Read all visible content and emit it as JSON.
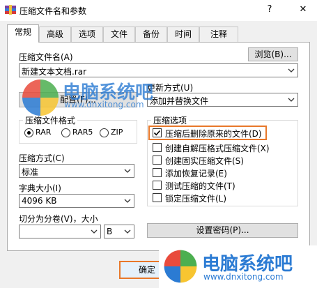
{
  "window": {
    "title": "压缩文件名和参数",
    "help": "?",
    "close": "✕"
  },
  "tabs": [
    "常规",
    "高级",
    "选项",
    "文件",
    "备份",
    "时间",
    "注释"
  ],
  "archive": {
    "label": "压缩文件名(A)",
    "value": "新建文本文档.rar",
    "browse": "浏览(B)..."
  },
  "profile": {
    "button": "配置(F)..."
  },
  "update": {
    "label": "更新方式(U)",
    "value": "添加并替换文件"
  },
  "format": {
    "label": "压缩文件格式",
    "options": [
      "RAR",
      "RAR5",
      "ZIP"
    ],
    "selected": "RAR"
  },
  "options": {
    "label": "压缩选项",
    "items": [
      {
        "label": "压缩后删除原来的文件(D)",
        "checked": true
      },
      {
        "label": "创建自解压格式压缩文件(X)",
        "checked": false
      },
      {
        "label": "创建固实压缩文件(S)",
        "checked": false
      },
      {
        "label": "添加恢复记录(E)",
        "checked": false
      },
      {
        "label": "测试压缩的文件(T)",
        "checked": false
      },
      {
        "label": "锁定压缩文件(L)",
        "checked": false
      }
    ]
  },
  "method": {
    "label": "压缩方式(C)",
    "value": "标准"
  },
  "dict": {
    "label": "字典大小(I)",
    "value": "4096 KB"
  },
  "split": {
    "label": "切分为分卷(V)，大小",
    "value": "",
    "unit": "B"
  },
  "password": {
    "button": "设置密码(P)..."
  },
  "footer": {
    "ok": "确定"
  },
  "watermark": {
    "text": "电脑系统吧",
    "url": "www.dnxitong.com"
  },
  "colors": {
    "highlight": "#e8782a",
    "watermark_blue": "#2b7bd3"
  }
}
